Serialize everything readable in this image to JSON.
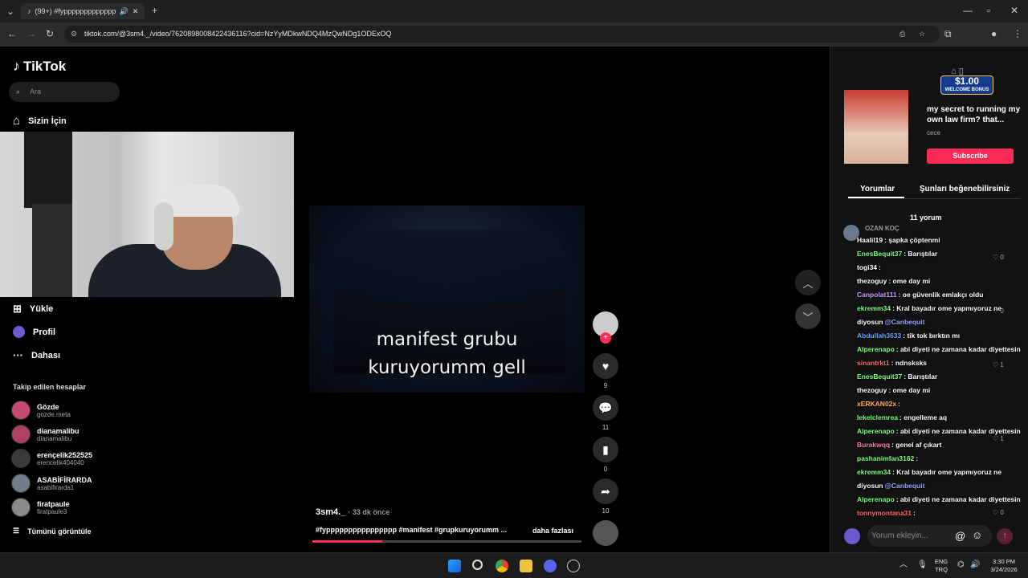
{
  "browser": {
    "tab_title": "(99+) #fyppppppppppppppp",
    "url": "tiktok.com/@3sm4._/video/7620898008422436116?cid=NzYyMDkwNDQ4MzQwNDg1ODExOQ"
  },
  "sidebar": {
    "logo": "TikTok",
    "search_placeholder": "Ara",
    "nav_main": "Sizin İçin",
    "nav_items": [
      "Yükle",
      "Profil",
      "Dahası"
    ],
    "following_header": "Takip edilen hesaplar",
    "accounts": [
      {
        "name": "Gözde",
        "handle": "gozde.meta"
      },
      {
        "name": "dianamalibu",
        "handle": "dianamalibu"
      },
      {
        "name": "erençelik252525",
        "handle": "erencelik404040"
      },
      {
        "name": "ASABİFİRARDA",
        "handle": "asabifirarda1"
      },
      {
        "name": "firatpaule",
        "handle": "firatpaule3"
      }
    ],
    "see_all": "Tümünü görüntüle"
  },
  "video": {
    "overlay_line1": "manifest grubu",
    "overlay_line2": "kuruyorumm gell",
    "author": "3sm4._",
    "time": "· 33 dk önce",
    "caption": "#fypppppppppppppppp #manifest #grupkuruyorumm ...",
    "more": "daha fazlası",
    "progress": 0.26,
    "likes": "9",
    "comments": "11",
    "saves": "0",
    "shares": "10"
  },
  "ad": {
    "bonus_amount": "$1.00",
    "bonus_label": "WELCOME BONUS",
    "text": "my secret to running my own law firm? that...",
    "author": "cece",
    "subscribe": "Subscribe"
  },
  "panel": {
    "tab_comments": "Yorumlar",
    "tab_like": "Şunları beğenebilirsiniz",
    "comment_count": "11 yorum",
    "first_commenter": "OZAN KOÇ",
    "input_placeholder": "Yorum ekleyin...",
    "chat": [
      {
        "user": "Haalil19",
        "text": ": şapka çöptenmi",
        "color": "#ffffff"
      },
      {
        "user": "EnesBequit37",
        "text": ": Barıştılar",
        "color": "#7dff7d"
      },
      {
        "user": "togi34",
        "text": ":",
        "color": "#ffffff"
      },
      {
        "user": "thezoguy",
        "text": ": ome day mi",
        "color": "#ffffff"
      },
      {
        "user": "Canpolat111",
        "text": ": oe güvenlik emlakçı oldu",
        "color": "#c9a0ff"
      },
      {
        "user": "ekremm34",
        "text": ": Kral bayadır ome yapmıyoruz ne",
        "color": "#7dff7d"
      },
      {
        "user": "diyosun",
        "text": "@Canbequit",
        "color": "#ffffff"
      },
      {
        "user": "Abdullah3633",
        "text": ": tik tok bırktın mı",
        "color": "#6aa8ff"
      },
      {
        "user": "Alperenapo",
        "text": ": abi diyeti ne zamana kadar diyettesin",
        "color": "#7dff7d"
      },
      {
        "user": "sinantrkt1",
        "text": ": ndnsksks",
        "color": "#ff6b6b"
      },
      {
        "user": "EnesBequit37",
        "text": ": Barıştılar",
        "color": "#7dff7d"
      },
      {
        "user": "thezoguy",
        "text": ": ome day mi",
        "color": "#ffffff"
      },
      {
        "user": "xERKAN02x",
        "text": ":",
        "color": "#ffb36b"
      },
      {
        "user": "lekelclemrea",
        "text": ": engelleme aq",
        "color": "#7dff7d"
      },
      {
        "user": "Alperenapo",
        "text": ": abi diyeti ne zamana kadar diyettesin",
        "color": "#7dff7d"
      },
      {
        "user": "Burakwqq",
        "text": ": genel af çıkart",
        "color": "#ff7da8"
      },
      {
        "user": "pashanimfan3162",
        "text": ":",
        "color": "#7dff7d"
      },
      {
        "user": "ekremm34",
        "text": ": Kral bayadır ome yapmıyoruz ne",
        "color": "#7dff7d"
      },
      {
        "user": "diyosun",
        "text": "@Canbequit",
        "color": "#ffffff"
      },
      {
        "user": "Alperenapo",
        "text": ": abi diyeti ne zamana kadar diyettesin",
        "color": "#7dff7d"
      },
      {
        "user": "tonnymontana31",
        "text": ":",
        "color": "#ff6b6b"
      }
    ],
    "like_counts": [
      "0",
      "0",
      "1",
      "1",
      "0"
    ]
  },
  "taskbar": {
    "lang1": "ENG",
    "lang2": "TRQ",
    "time": "3:30 PM",
    "date": "3/24/2026"
  }
}
